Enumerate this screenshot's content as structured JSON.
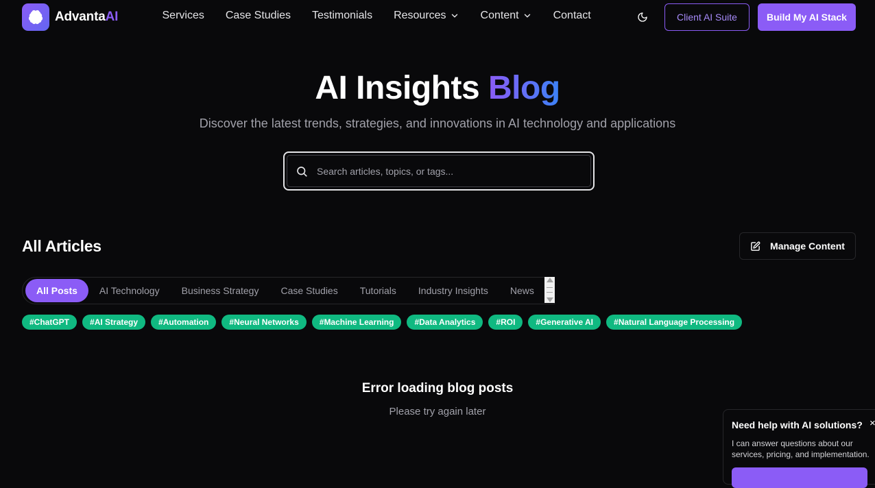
{
  "header": {
    "logo_text": "Advanta",
    "logo_accent": "AI",
    "nav": [
      {
        "label": "Services",
        "has_dropdown": false
      },
      {
        "label": "Case Studies",
        "has_dropdown": false
      },
      {
        "label": "Testimonials",
        "has_dropdown": false
      },
      {
        "label": "Resources",
        "has_dropdown": true
      },
      {
        "label": "Content",
        "has_dropdown": true
      },
      {
        "label": "Contact",
        "has_dropdown": false
      }
    ],
    "theme_toggle_icon": "moon-icon",
    "client_button": "Client AI Suite",
    "cta_button": "Build My AI Stack"
  },
  "hero": {
    "title": "AI Insights",
    "title_accent": "Blog",
    "subtitle": "Discover the latest trends, strategies, and innovations in AI technology and applications",
    "search_placeholder": "Search articles, topics, or tags..."
  },
  "articles": {
    "title": "All Articles",
    "manage_button": "Manage Content",
    "tabs": [
      "All Posts",
      "AI Technology",
      "Business Strategy",
      "Case Studies",
      "Tutorials",
      "Industry Insights",
      "News"
    ],
    "active_tab": "All Posts",
    "tags": [
      "#ChatGPT",
      "#AI Strategy",
      "#Automation",
      "#Neural Networks",
      "#Machine Learning",
      "#Data Analytics",
      "#ROI",
      "#Generative AI",
      "#Natural Language Processing"
    ],
    "error_title": "Error loading blog posts",
    "error_subtitle": "Please try again later"
  },
  "chat": {
    "title": "Need help with AI solutions?",
    "body": "I can answer questions about our services, pricing, and implementation.",
    "close": "×"
  },
  "colors": {
    "background": "#09090b",
    "accent": "#8b5cf6",
    "tag": "#10b981",
    "muted_text": "#a1a1aa"
  }
}
